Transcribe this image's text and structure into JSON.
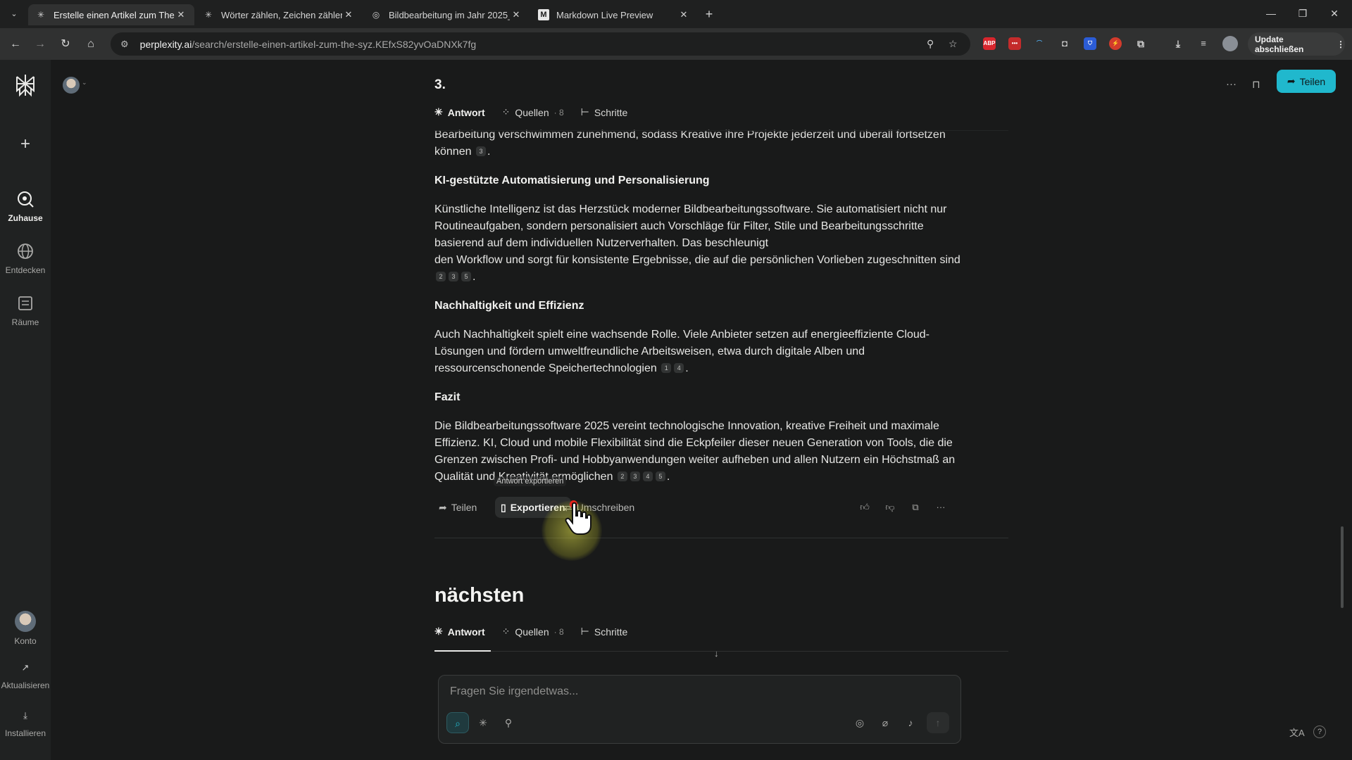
{
  "browser": {
    "tabs": [
      {
        "title": "Erstelle einen Artikel zum Ther",
        "favicon": "perplexity-icon",
        "active": true
      },
      {
        "title": "Wörter zählen, Zeichen zählen",
        "favicon": "perplexity-icon",
        "active": false
      },
      {
        "title": "Bildbearbeitung im Jahr 2025_",
        "favicon": "globe-icon",
        "active": false
      },
      {
        "title": "Markdown Live Preview",
        "favicon": "m-icon",
        "active": false
      }
    ],
    "url_host": "perplexity.ai",
    "url_path": "/search/erstelle-einen-artikel-zum-the-syz.KEfxS82yvOaDNXk7fg",
    "extensions": [
      {
        "label": "ABP",
        "color": "#d8262d"
      },
      {
        "label": "•••",
        "color": "#c42b2b"
      }
    ],
    "update_label": "Update abschließen"
  },
  "sidebar": {
    "items": [
      {
        "label": "Zuhause",
        "icon": "home-search-icon",
        "active": true
      },
      {
        "label": "Entdecken",
        "icon": "globe-icon",
        "active": false
      },
      {
        "label": "Räume",
        "icon": "spaces-icon",
        "active": false
      }
    ],
    "bottom": [
      {
        "label": "Konto",
        "icon": "avatar"
      },
      {
        "label": "Aktualisieren",
        "icon": "arrow-up-right-icon"
      },
      {
        "label": "Installieren",
        "icon": "download-icon"
      }
    ]
  },
  "header": {
    "share_label": "Teilen"
  },
  "thread1": {
    "title": "3.",
    "tabs": {
      "answer": "Antwort",
      "sources": "Quellen",
      "sources_count": "8",
      "steps": "Schritte"
    }
  },
  "article": {
    "p0": "Bearbeitung verschwimmen zunehmend, sodass Kreative ihre Projekte jederzeit und überall fortsetzen können",
    "p0_cites": [
      "3"
    ],
    "h1": "KI-gestützte Automatisierung und Personalisierung",
    "p1_a": "Künstliche Intelligenz ist das Herzstück moderner Bildbearbeitungssoftware. Sie automatisiert nicht nur Routineaufgaben, sondern personalisiert auch Vorschläge für Filter, Stile und Bearbeitungsschritte basierend auf dem individuellen Nutzerverhalten. Das beschleunigt",
    "p1_b": "den Workflow und sorgt für konsistente Ergebnisse, die auf die persönlichen Vorlieben zugeschnitten sind",
    "p1_cites": [
      "2",
      "3",
      "5"
    ],
    "h2": "Nachhaltigkeit und Effizienz",
    "p2": "Auch Nachhaltigkeit spielt eine wachsende Rolle. Viele Anbieter setzen auf energieeffiziente Cloud-Lösungen und fördern umweltfreundliche Arbeitsweisen, etwa durch digitale Alben und ressourcenschonende Speichertechnologien",
    "p2_cites": [
      "1",
      "4"
    ],
    "h3": "Fazit",
    "p3": "Die Bildbearbeitungssoftware 2025 vereint technologische Innovation, kreative Freiheit und maximale Effizienz. KI, Cloud und mobile Flexibilität sind die Eckpfeiler dieser neuen Generation von Tools, die die Grenzen zwischen Profi- und Hobbyanwendungen weiter aufheben und allen Nutzern ein Höchstmaß an Qualität und Kreativität ermöglichen",
    "p3_cites": [
      "2",
      "3",
      "4",
      "5"
    ]
  },
  "actions": {
    "share": "Teilen",
    "export": "Exportieren",
    "export_tooltip": "Antwort exportieren",
    "rewrite": "Umschreiben"
  },
  "thread2": {
    "title": "nächsten",
    "tabs": {
      "answer": "Antwort",
      "sources": "Quellen",
      "sources_count": "8",
      "steps": "Schritte"
    }
  },
  "ask": {
    "placeholder": "Fragen Sie irgendetwas..."
  },
  "colors": {
    "accent": "#20b8cd",
    "background": "#191a1a",
    "sidebar": "#202222"
  }
}
